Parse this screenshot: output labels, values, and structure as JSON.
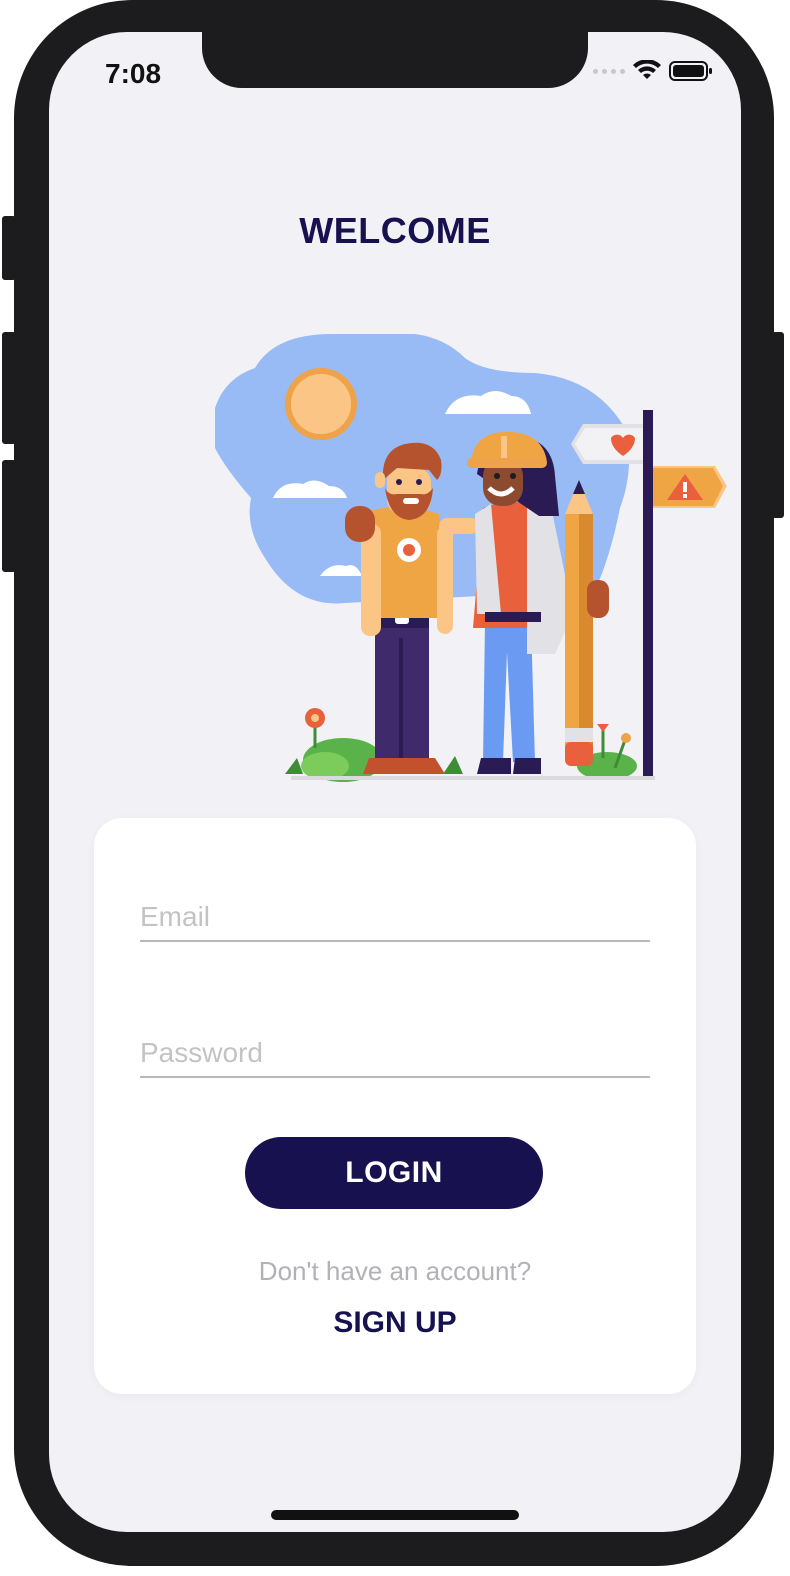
{
  "status_bar": {
    "time": "7:08"
  },
  "header": {
    "title": "WELCOME"
  },
  "form": {
    "email": {
      "placeholder": "Email",
      "value": ""
    },
    "password": {
      "placeholder": "Password",
      "value": ""
    },
    "login_label": "LOGIN",
    "no_account_text": "Don't have an account?",
    "signup_label": "SIGN UP"
  },
  "colors": {
    "brand": "#17124f",
    "background": "#f2f2f6",
    "card": "#ffffff",
    "placeholder": "#c3c3c6"
  },
  "icons": [
    "wifi-icon",
    "battery-icon",
    "signal-dots-icon",
    "heart-icon",
    "warning-icon"
  ]
}
